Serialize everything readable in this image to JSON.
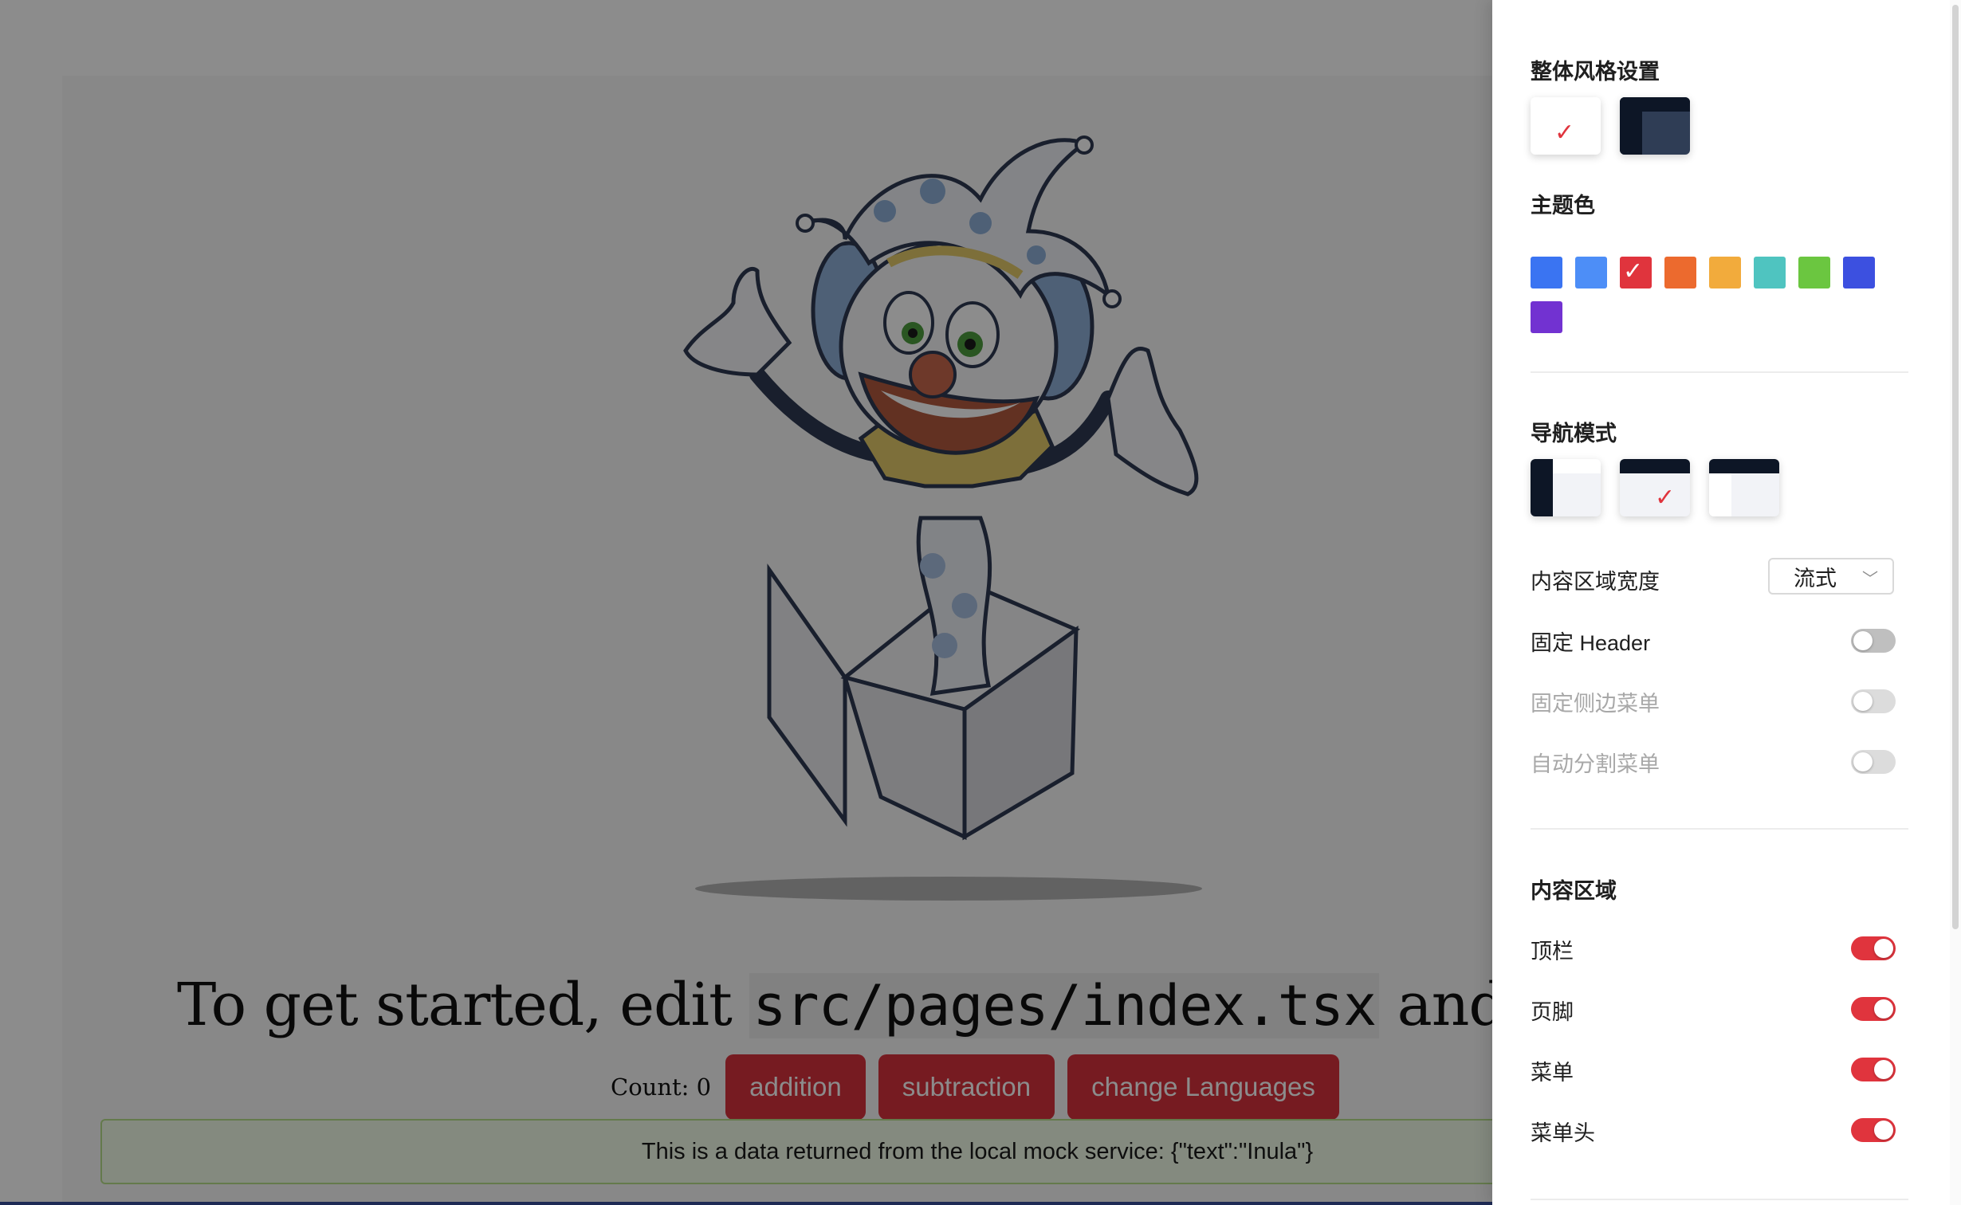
{
  "background_page": {
    "headline_before": "To get started, edit ",
    "headline_code": "src/pages/index.tsx",
    "headline_after": " and save",
    "count_label": "Count: 0",
    "buttons": {
      "addition": "addition",
      "subtraction": "subtraction",
      "change_languages": "change Languages"
    },
    "mock_banner": "This is a data returned from the local mock service: {\"text\":\"Inula\"}"
  },
  "drawer": {
    "overall_style": {
      "title": "整体风格设置",
      "options": [
        {
          "name": "light",
          "selected": true
        },
        {
          "name": "dark",
          "selected": false
        }
      ]
    },
    "theme_color": {
      "title": "主题色",
      "colors": [
        "#3a74f2",
        "#4d8ef7",
        "#e0343d",
        "#ec6a2e",
        "#f2ab3c",
        "#4fc4c0",
        "#6bc640",
        "#3c50e0",
        "#7232d1"
      ],
      "selected": "#e0343d"
    },
    "nav_mode": {
      "title": "导航模式",
      "options": [
        {
          "name": "side-menu",
          "selected": false
        },
        {
          "name": "top-menu",
          "selected": true
        },
        {
          "name": "mix-menu",
          "selected": false
        }
      ]
    },
    "settings": {
      "content_width_label": "内容区域宽度",
      "content_width_value": "流式",
      "fixed_header_label": "固定 Header",
      "fixed_sider_label": "固定侧边菜单",
      "split_menu_label": "自动分割菜单"
    },
    "content_area": {
      "title": "内容区域",
      "items": [
        {
          "label": "顶栏",
          "on": true
        },
        {
          "label": "页脚",
          "on": true
        },
        {
          "label": "菜单",
          "on": true
        },
        {
          "label": "菜单头",
          "on": true
        }
      ]
    }
  }
}
